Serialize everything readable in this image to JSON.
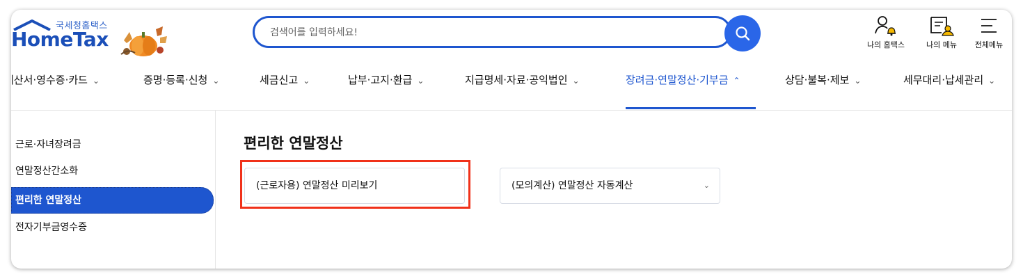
{
  "header": {
    "brand_small": "국세청홈택스",
    "brand_big": "HomeTax",
    "search_placeholder": "검색어를 입력하세요!",
    "util": {
      "my_hometax": "나의 홈택스",
      "my_menu": "나의 메뉴",
      "all_menu": "전체메뉴"
    }
  },
  "gnb": {
    "items": [
      {
        "label": "세금계산서·영수증·카드",
        "display": "계산서·영수증·카드"
      },
      {
        "label": "증명·등록·신청"
      },
      {
        "label": "세금신고"
      },
      {
        "label": "납부·고지·환급"
      },
      {
        "label": "지급명세·자료·공익법인"
      },
      {
        "label": "장려금·연말정산·기부금",
        "active": true
      },
      {
        "label": "상담·불복·제보"
      },
      {
        "label": "세무대리·납세관리"
      }
    ]
  },
  "lnb": {
    "items": [
      {
        "label": "근로·자녀장려금"
      },
      {
        "label": "연말정산간소화"
      },
      {
        "label": "편리한 연말정산",
        "active": true
      },
      {
        "label": "전자기부금영수증"
      }
    ]
  },
  "content": {
    "title": "편리한 연말정산",
    "cards": [
      {
        "label": "(근로자용) 연말정산 미리보기",
        "highlighted": true
      },
      {
        "label": "(모의계산) 연말정산 자동계산",
        "has_dropdown": true
      }
    ]
  },
  "colors": {
    "primary": "#1e56cf",
    "highlight_border": "#f0311a",
    "search_button": "#2a66e8"
  }
}
